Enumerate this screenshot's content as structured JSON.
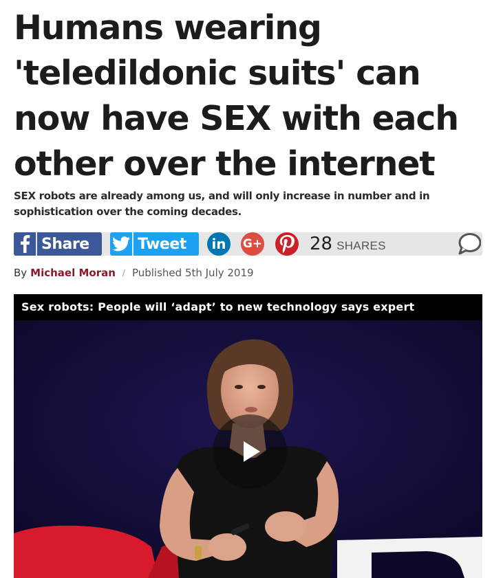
{
  "article": {
    "headline": "Humans wearing 'teledildonic suits' can now have SEX with each other over the internet",
    "standfirst": "SEX robots are already among us, and will only increase in number and in sophistication over the coming decades."
  },
  "share": {
    "facebook_label": "Share",
    "twitter_label": "Tweet",
    "linkedin_glyph": "in",
    "googleplus_glyph": "G+",
    "count": "28",
    "count_label": "SHARES",
    "colors": {
      "facebook": "#3b5998",
      "twitter": "#1da1f2",
      "linkedin": "#0077b5",
      "googleplus": "#dc4e41",
      "pinterest": "#cb2027"
    },
    "icons": [
      "facebook-icon",
      "twitter-icon",
      "linkedin-icon",
      "google-plus-icon",
      "pinterest-icon",
      "comment-icon"
    ]
  },
  "byline": {
    "prefix": "By",
    "author": "Michael Moran",
    "separator": "/",
    "published": "Published 5th July 2019",
    "author_color": "#8b1a2b"
  },
  "video": {
    "title": "Sex robots: People will ‘adapt’ to new technology says expert",
    "icon": "play-icon"
  }
}
